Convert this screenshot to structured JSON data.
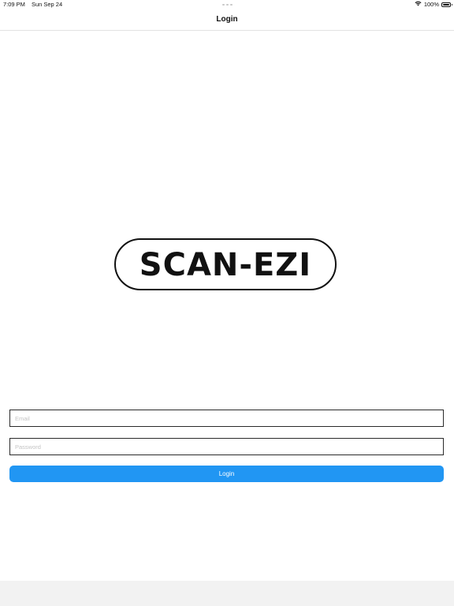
{
  "status_bar": {
    "time": "7:09 PM",
    "date": "Sun Sep 24",
    "battery_text": "100%",
    "battery_level": 1.0,
    "icons": [
      "wifi-icon",
      "battery-icon"
    ]
  },
  "nav": {
    "title": "Login"
  },
  "logo": {
    "text": "SCAN-EZI"
  },
  "form": {
    "email_placeholder": "Email",
    "email_value": "",
    "password_placeholder": "Password",
    "password_value": "",
    "login_label": "Login"
  },
  "colors": {
    "accent": "#2196f3",
    "bottom_area": "#f2f2f2",
    "text": "#111111"
  }
}
